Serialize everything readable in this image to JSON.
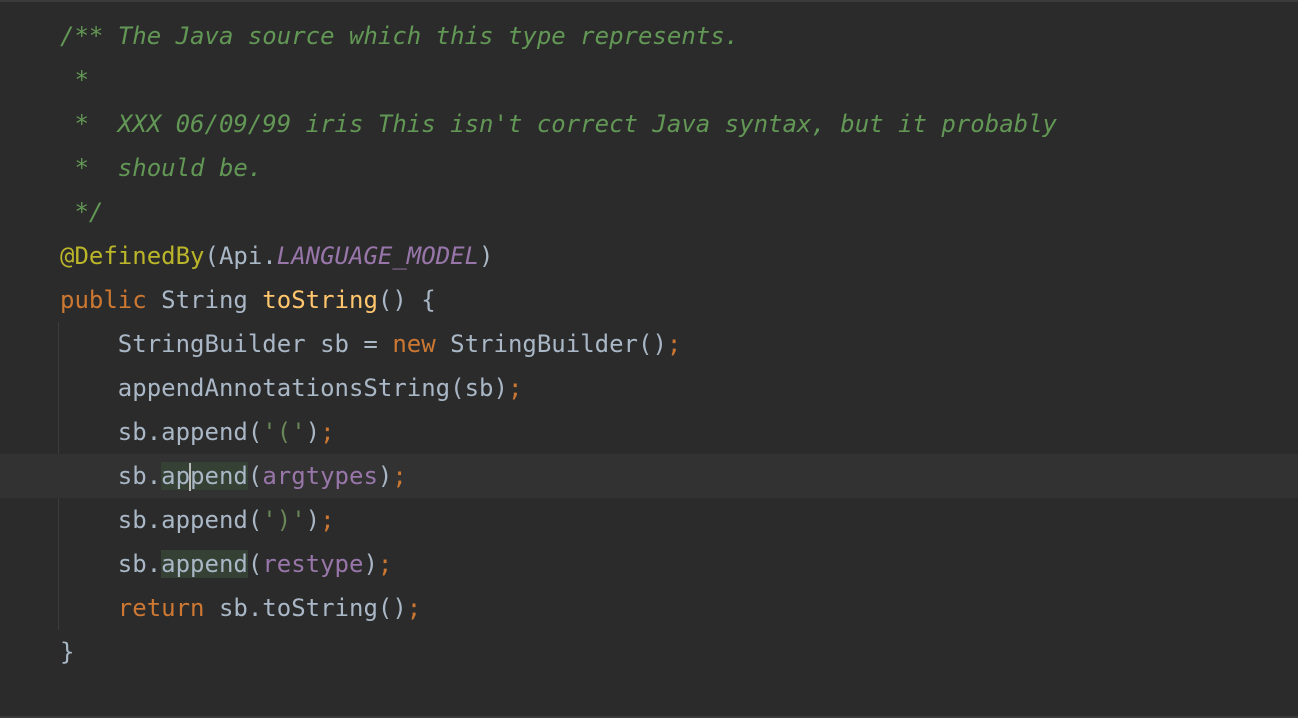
{
  "editor": {
    "language": "java",
    "lines": {
      "l1": "/** The Java source which this type represents.",
      "l2": " *",
      "l3": " *  XXX 06/09/99 iris This isn't correct Java syntax, but it probably",
      "l4": " *  should be.",
      "l5": " */",
      "l6_annotation": "@DefinedBy",
      "l6_open": "(Api.",
      "l6_const": "LANGUAGE_MODEL",
      "l6_close": ")",
      "l7_kw": "public",
      "l7_type": " String ",
      "l7_method": "toString",
      "l7_rest": "() {",
      "l8_indent": "    ",
      "l8_a": "StringBuilder sb = ",
      "l8_kw": "new",
      "l8_b": " StringBuilder()",
      "l8_semi": ";",
      "l9_a": "appendAnnotationsString(sb)",
      "l9_semi": ";",
      "l10_a": "sb.append(",
      "l10_str": "'('",
      "l10_b": ")",
      "l10_semi": ";",
      "l11_a": "sb.",
      "l11_hl_before": "ap",
      "l11_hl_after": "pend",
      "l11_b": "(",
      "l11_param": "argtypes",
      "l11_c": ")",
      "l11_semi": ";",
      "l12_a": "sb.append(",
      "l12_str": "')'",
      "l12_b": ")",
      "l12_semi": ";",
      "l13_a": "sb.",
      "l13_hl": "append",
      "l13_b": "(",
      "l13_param": "restype",
      "l13_c": ")",
      "l13_semi": ";",
      "l14_kw": "return",
      "l14_a": " sb.toString()",
      "l14_semi": ";",
      "l15": "}"
    }
  },
  "colors": {
    "background": "#2b2b2b",
    "current_line": "#323232",
    "comment": "#629755",
    "keyword": "#cc7832",
    "annotation": "#bbb529",
    "method_declaration": "#ffc66d",
    "field": "#9876aa",
    "string": "#6a8759",
    "default_text": "#a9b7c6",
    "usage_highlight": "#344134"
  }
}
